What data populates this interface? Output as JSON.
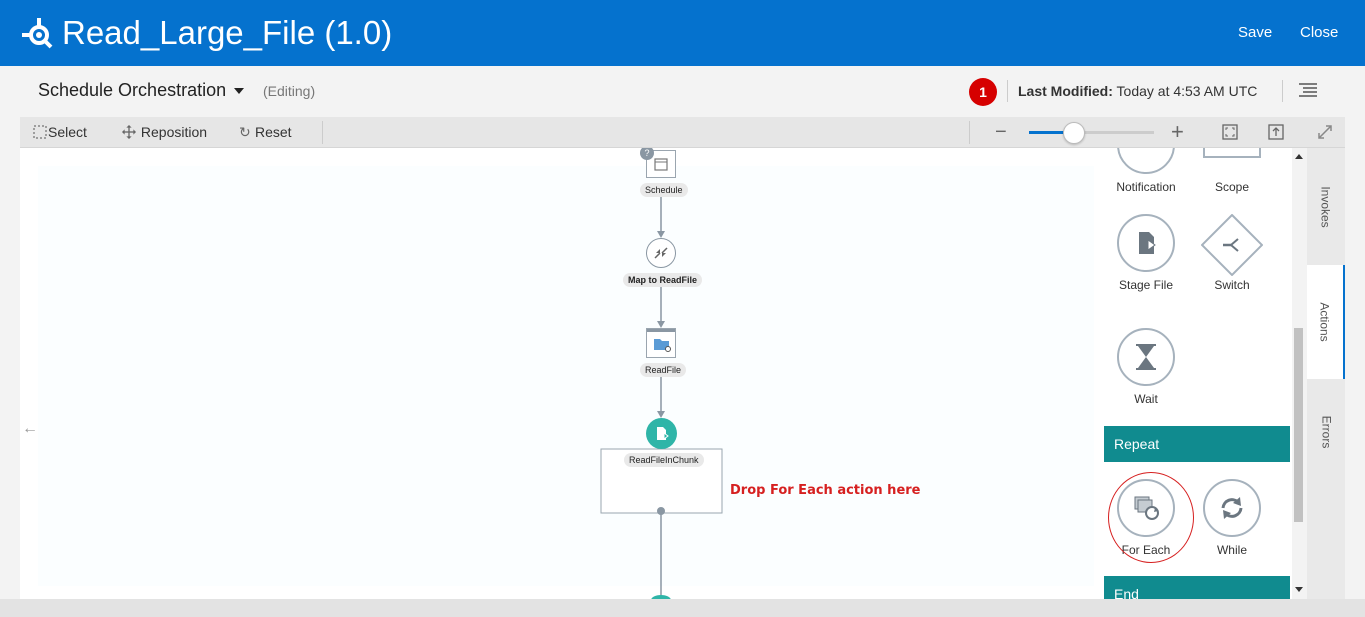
{
  "header": {
    "title": "Read_Large_File (1.0)",
    "save_label": "Save",
    "close_label": "Close",
    "brand_color": "#0572ce"
  },
  "subheader": {
    "orchestration_title": "Schedule Orchestration",
    "editing_label": "(Editing)",
    "badge_count": "1",
    "last_modified_label": "Last Modified:",
    "last_modified_value": "Today at 4:53 AM UTC"
  },
  "toolbar": {
    "select_label": "Select",
    "reposition_label": "Reposition",
    "reset_label": "Reset",
    "zoom_level": 0.3
  },
  "canvas": {
    "nodes": [
      {
        "label": "Schedule",
        "icon": "schedule-icon"
      },
      {
        "label": "Map to ReadFile",
        "icon": "map-icon"
      },
      {
        "label": "ReadFile",
        "icon": "file-read-icon"
      },
      {
        "label": "ReadFileInChunk",
        "icon": "stage-file-icon"
      }
    ],
    "drop_hint": "Drop For Each action here"
  },
  "palette": {
    "items": [
      {
        "label": "Notification",
        "icon": "notification-icon"
      },
      {
        "label": "Scope",
        "icon": "scope-icon"
      },
      {
        "label": "Stage File",
        "icon": "stage-file-icon"
      },
      {
        "label": "Switch",
        "icon": "switch-icon"
      },
      {
        "label": "Wait",
        "icon": "hourglass-icon"
      },
      {
        "label": "For Each",
        "icon": "for-each-icon"
      },
      {
        "label": "While",
        "icon": "loop-icon"
      }
    ],
    "repeat_header": "Repeat",
    "end_header": "End",
    "section_color": "#108b8f"
  },
  "tabs": {
    "invokes": "Invokes",
    "actions": "Actions",
    "errors": "Errors"
  }
}
